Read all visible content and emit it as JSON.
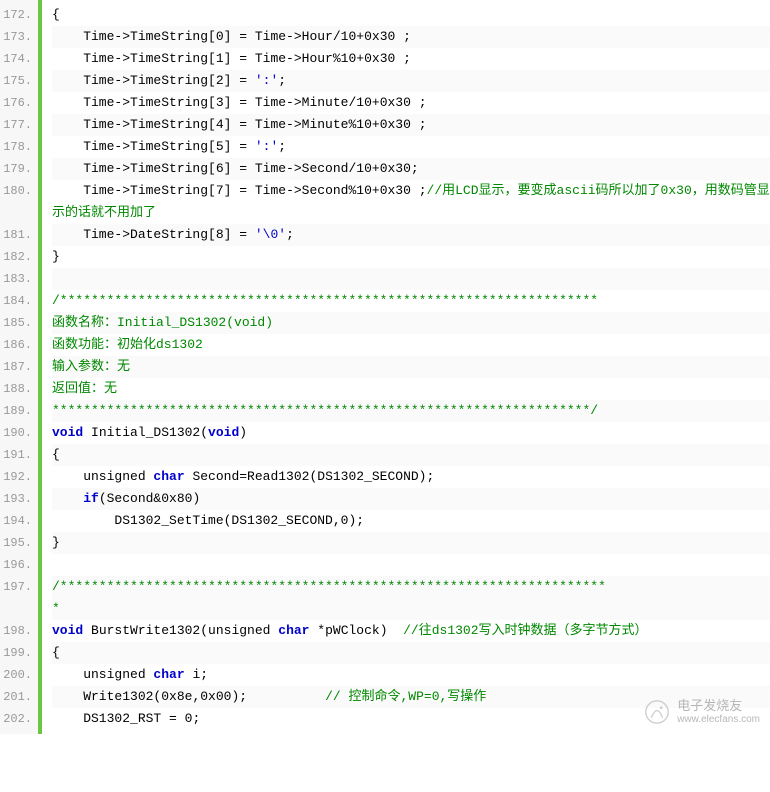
{
  "watermark": {
    "title": "电子发烧友",
    "url": "www.elecfans.com"
  },
  "lines": [
    {
      "n": "172.",
      "tokens": [
        {
          "t": "{",
          "c": null
        }
      ]
    },
    {
      "n": "173.",
      "tokens": [
        {
          "t": "    Time->TimeString[",
          "c": null
        },
        {
          "t": "0",
          "c": "num"
        },
        {
          "t": "] = Time->Hour/",
          "c": null
        },
        {
          "t": "10",
          "c": "num"
        },
        {
          "t": "+",
          "c": null
        },
        {
          "t": "0x30",
          "c": "num"
        },
        {
          "t": " ;",
          "c": null
        }
      ]
    },
    {
      "n": "174.",
      "tokens": [
        {
          "t": "    Time->TimeString[",
          "c": null
        },
        {
          "t": "1",
          "c": "num"
        },
        {
          "t": "] = Time->Hour%",
          "c": null
        },
        {
          "t": "10",
          "c": "num"
        },
        {
          "t": "+",
          "c": null
        },
        {
          "t": "0x30",
          "c": "num"
        },
        {
          "t": " ;",
          "c": null
        }
      ]
    },
    {
      "n": "175.",
      "tokens": [
        {
          "t": "    Time->TimeString[",
          "c": null
        },
        {
          "t": "2",
          "c": "num"
        },
        {
          "t": "] = ",
          "c": null
        },
        {
          "t": "':'",
          "c": "str"
        },
        {
          "t": ";",
          "c": null
        }
      ]
    },
    {
      "n": "176.",
      "tokens": [
        {
          "t": "    Time->TimeString[",
          "c": null
        },
        {
          "t": "3",
          "c": "num"
        },
        {
          "t": "] = Time->Minute/",
          "c": null
        },
        {
          "t": "10",
          "c": "num"
        },
        {
          "t": "+",
          "c": null
        },
        {
          "t": "0x30",
          "c": "num"
        },
        {
          "t": " ;",
          "c": null
        }
      ]
    },
    {
      "n": "177.",
      "tokens": [
        {
          "t": "    Time->TimeString[",
          "c": null
        },
        {
          "t": "4",
          "c": "num"
        },
        {
          "t": "] = Time->Minute%",
          "c": null
        },
        {
          "t": "10",
          "c": "num"
        },
        {
          "t": "+",
          "c": null
        },
        {
          "t": "0x30",
          "c": "num"
        },
        {
          "t": " ;",
          "c": null
        }
      ]
    },
    {
      "n": "178.",
      "tokens": [
        {
          "t": "    Time->TimeString[",
          "c": null
        },
        {
          "t": "5",
          "c": "num"
        },
        {
          "t": "] = ",
          "c": null
        },
        {
          "t": "':'",
          "c": "str"
        },
        {
          "t": ";",
          "c": null
        }
      ]
    },
    {
      "n": "179.",
      "tokens": [
        {
          "t": "    Time->TimeString[",
          "c": null
        },
        {
          "t": "6",
          "c": "num"
        },
        {
          "t": "] = Time->Second/",
          "c": null
        },
        {
          "t": "10",
          "c": "num"
        },
        {
          "t": "+",
          "c": null
        },
        {
          "t": "0x30",
          "c": "num"
        },
        {
          "t": ";",
          "c": null
        }
      ]
    },
    {
      "n": "180.",
      "wrap": true,
      "tokens": [
        {
          "t": "    Time->TimeString[",
          "c": null
        },
        {
          "t": "7",
          "c": "num"
        },
        {
          "t": "] = Time->Second%",
          "c": null
        },
        {
          "t": "10",
          "c": "num"
        },
        {
          "t": "+",
          "c": null
        },
        {
          "t": "0x30",
          "c": "num"
        },
        {
          "t": " ;",
          "c": null
        },
        {
          "t": "//用LCD显示，要变成ascii码所以加了0x30，用数码管显示的话就不用加了",
          "c": "comment"
        }
      ]
    },
    {
      "n": "181.",
      "tokens": [
        {
          "t": "    Time->DateString[",
          "c": null
        },
        {
          "t": "8",
          "c": "num"
        },
        {
          "t": "] = ",
          "c": null
        },
        {
          "t": "'\\0'",
          "c": "str"
        },
        {
          "t": ";",
          "c": null
        }
      ]
    },
    {
      "n": "182.",
      "tokens": [
        {
          "t": "}",
          "c": null
        }
      ]
    },
    {
      "n": "183.",
      "tokens": [
        {
          "t": "",
          "c": null
        }
      ]
    },
    {
      "n": "184.",
      "tokens": [
        {
          "t": "/*********************************************************************",
          "c": "comment"
        }
      ]
    },
    {
      "n": "185.",
      "tokens": [
        {
          "t": "函数名称：Initial_DS1302(void)",
          "c": "comment"
        }
      ]
    },
    {
      "n": "186.",
      "tokens": [
        {
          "t": "函数功能：初始化ds1302",
          "c": "comment"
        }
      ]
    },
    {
      "n": "187.",
      "tokens": [
        {
          "t": "输入参数：无",
          "c": "comment"
        }
      ]
    },
    {
      "n": "188.",
      "tokens": [
        {
          "t": "返回值：无",
          "c": "comment"
        }
      ]
    },
    {
      "n": "189.",
      "tokens": [
        {
          "t": "*********************************************************************/",
          "c": "comment"
        }
      ]
    },
    {
      "n": "190.",
      "tokens": [
        {
          "t": "void",
          "c": "kw"
        },
        {
          "t": " Initial_DS1302(",
          "c": null
        },
        {
          "t": "void",
          "c": "kw"
        },
        {
          "t": ")",
          "c": null
        }
      ]
    },
    {
      "n": "191.",
      "tokens": [
        {
          "t": "{",
          "c": null
        }
      ]
    },
    {
      "n": "192.",
      "tokens": [
        {
          "t": "    unsigned ",
          "c": null
        },
        {
          "t": "char",
          "c": "kw"
        },
        {
          "t": " Second=Read1302(DS1302_SECOND);",
          "c": null
        }
      ]
    },
    {
      "n": "193.",
      "tokens": [
        {
          "t": "    ",
          "c": null
        },
        {
          "t": "if",
          "c": "kw"
        },
        {
          "t": "(Second&",
          "c": null
        },
        {
          "t": "0x80",
          "c": "num"
        },
        {
          "t": ")",
          "c": null
        }
      ]
    },
    {
      "n": "194.",
      "tokens": [
        {
          "t": "        DS1302_SetTime(DS1302_SECOND,",
          "c": null
        },
        {
          "t": "0",
          "c": "num"
        },
        {
          "t": ");",
          "c": null
        }
      ]
    },
    {
      "n": "195.",
      "tokens": [
        {
          "t": "}",
          "c": null
        }
      ]
    },
    {
      "n": "196.",
      "tokens": [
        {
          "t": "",
          "c": null
        }
      ]
    },
    {
      "n": "197.",
      "wrap": true,
      "tokens": [
        {
          "t": "/**********************************************************************",
          "c": "comment"
        }
      ]
    },
    {
      "n": "198.",
      "tokens": [
        {
          "t": "void",
          "c": "kw"
        },
        {
          "t": " BurstWrite1302(unsigned ",
          "c": null
        },
        {
          "t": "char",
          "c": "kw"
        },
        {
          "t": " *pWClock)  ",
          "c": null
        },
        {
          "t": "//往ds1302写入时钟数据（多字节方式）",
          "c": "comment"
        }
      ]
    },
    {
      "n": "199.",
      "tokens": [
        {
          "t": "{",
          "c": null
        }
      ]
    },
    {
      "n": "200.",
      "tokens": [
        {
          "t": "    unsigned ",
          "c": null
        },
        {
          "t": "char",
          "c": "kw"
        },
        {
          "t": " i;",
          "c": null
        }
      ]
    },
    {
      "n": "201.",
      "tokens": [
        {
          "t": "    Write1302(",
          "c": null
        },
        {
          "t": "0x8e",
          "c": "num"
        },
        {
          "t": ",",
          "c": null
        },
        {
          "t": "0x00",
          "c": "num"
        },
        {
          "t": ");          ",
          "c": null
        },
        {
          "t": "// 控制命令,WP=0,写操作",
          "c": "comment"
        }
      ]
    },
    {
      "n": "202.",
      "tokens": [
        {
          "t": "    DS1302_RST = ",
          "c": null
        },
        {
          "t": "0",
          "c": "num"
        },
        {
          "t": ";",
          "c": null
        }
      ]
    }
  ]
}
